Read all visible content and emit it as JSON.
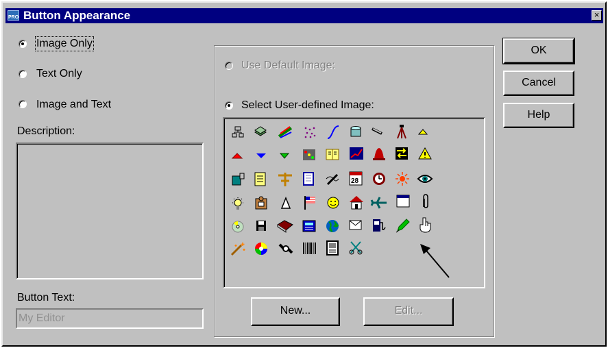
{
  "window": {
    "title": "Button Appearance",
    "app_icon_text": "PRO",
    "close_glyph": "×"
  },
  "options": {
    "image_only": "Image Only",
    "text_only": "Text Only",
    "image_and_text": "Image and Text",
    "selected": "image_only"
  },
  "description": {
    "label": "Description:",
    "value": ""
  },
  "button_text": {
    "label": "Button Text:",
    "value": "My Editor"
  },
  "image_source": {
    "use_default": "Use Default Image:",
    "select_user_defined": "Select User-defined Image:",
    "selected": "user_defined"
  },
  "icon_grid": {
    "rows": [
      [
        "network-icon",
        "layers-icon",
        "paint-stroke-icon",
        "dots-icon",
        "curve-icon",
        "cylinder-icon",
        "magnifier-tool-icon",
        "survey-tripod-icon",
        "triangle-up-small-icon"
      ],
      [
        "triangle-red-icon",
        "triangle-down-blue-icon",
        "triangle-down-green-icon",
        "traffic-signal-icon",
        "book-icon",
        "line-graph-icon",
        "bell-icon",
        "hazard-sign-icon",
        "warning-icon"
      ],
      [
        "camera-icon",
        "notepad-icon",
        "ruler-icon",
        "table-icon",
        "pen-script-icon",
        "calendar-icon",
        "clock-icon",
        "sun-icon",
        "eye-icon"
      ],
      [
        "light-bulb-icon",
        "puzzle-icon",
        "cone-icon",
        "flag-icon",
        "smiley-icon",
        "house-icon",
        "airplane-icon",
        "window-icon",
        "paperclip-icon"
      ],
      [
        "compact-disc-icon",
        "floppy-disk-icon",
        "book-closed-icon",
        "calculator-icon",
        "globe-icon",
        "envelope-icon",
        "gas-pump-icon",
        "pencil-icon",
        "hand-pointer-icon"
      ],
      [
        "magic-wand-icon",
        "color-wheel-icon",
        "satellite-icon",
        "barcode-icon",
        "document-icon",
        "scissors-icon"
      ]
    ],
    "selected": "pencil-icon"
  },
  "buttons": {
    "ok": "OK",
    "cancel": "Cancel",
    "help": "Help",
    "new": "New...",
    "edit": "Edit..."
  },
  "colors": {
    "titlebar": "#000080",
    "dialog_face": "#c0c0c0",
    "highlight": "#ffffff",
    "shadow": "#808080"
  }
}
